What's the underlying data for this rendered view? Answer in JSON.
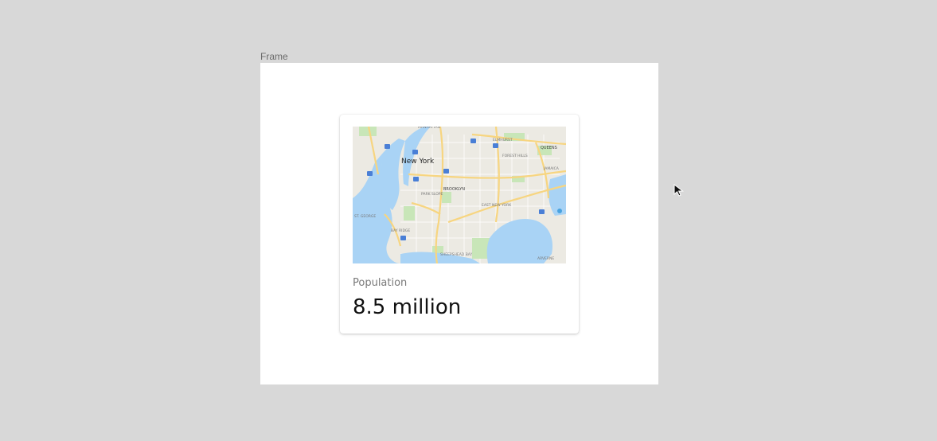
{
  "frame": {
    "label": "Frame"
  },
  "card": {
    "label": "Population",
    "value": "8.5 million",
    "map": {
      "city_label": "New York",
      "neighborhoods": [
        "MANHATTAN",
        "ELMHURST",
        "QUEENS",
        "FOREST HILLS",
        "JAMAICA",
        "BROOKLYN",
        "PARK SLOPE",
        "EAST NEW YORK",
        "ST. GEORGE",
        "BAY RIDGE",
        "SHEEPSHEAD BAY",
        "ARVERNE"
      ],
      "water_color": "#a9d3f5",
      "land_color": "#eceae3",
      "park_color": "#c8e6b8",
      "road_color": "#f7d580"
    }
  },
  "cursor": {
    "icon": "arrow-cursor-icon"
  }
}
